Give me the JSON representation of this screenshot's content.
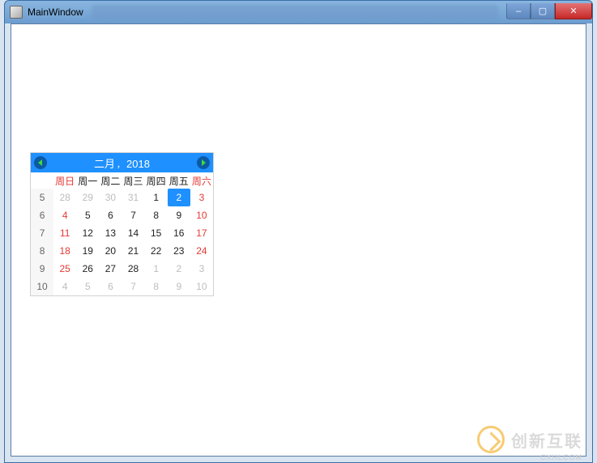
{
  "window": {
    "title": "MainWindow",
    "buttons": {
      "min": "–",
      "max": "▢",
      "close": "✕"
    }
  },
  "calendar": {
    "header": {
      "month": "二月",
      "sep": "，",
      "year": "2018"
    },
    "dow": [
      "周日",
      "周一",
      "周二",
      "周三",
      "周四",
      "周五",
      "周六"
    ],
    "rows": [
      {
        "week": "5",
        "days": [
          {
            "n": "28",
            "dim": true
          },
          {
            "n": "29",
            "dim": true
          },
          {
            "n": "30",
            "dim": true
          },
          {
            "n": "31",
            "dim": true
          },
          {
            "n": "1"
          },
          {
            "n": "2",
            "sel": true
          },
          {
            "n": "3",
            "red": true
          }
        ]
      },
      {
        "week": "6",
        "days": [
          {
            "n": "4",
            "red": true
          },
          {
            "n": "5"
          },
          {
            "n": "6"
          },
          {
            "n": "7"
          },
          {
            "n": "8"
          },
          {
            "n": "9"
          },
          {
            "n": "10",
            "red": true
          }
        ]
      },
      {
        "week": "7",
        "days": [
          {
            "n": "11",
            "red": true
          },
          {
            "n": "12"
          },
          {
            "n": "13"
          },
          {
            "n": "14"
          },
          {
            "n": "15"
          },
          {
            "n": "16"
          },
          {
            "n": "17",
            "red": true
          }
        ]
      },
      {
        "week": "8",
        "days": [
          {
            "n": "18",
            "red": true
          },
          {
            "n": "19"
          },
          {
            "n": "20"
          },
          {
            "n": "21"
          },
          {
            "n": "22"
          },
          {
            "n": "23"
          },
          {
            "n": "24",
            "red": true
          }
        ]
      },
      {
        "week": "9",
        "days": [
          {
            "n": "25",
            "red": true
          },
          {
            "n": "26"
          },
          {
            "n": "27"
          },
          {
            "n": "28"
          },
          {
            "n": "1",
            "dim": true
          },
          {
            "n": "2",
            "dim": true
          },
          {
            "n": "3",
            "dim": true
          }
        ]
      },
      {
        "week": "10",
        "days": [
          {
            "n": "4",
            "dim": true
          },
          {
            "n": "5",
            "dim": true
          },
          {
            "n": "6",
            "dim": true
          },
          {
            "n": "7",
            "dim": true
          },
          {
            "n": "8",
            "dim": true
          },
          {
            "n": "9",
            "dim": true
          },
          {
            "n": "10",
            "dim": true
          }
        ]
      }
    ]
  },
  "watermark": {
    "brand": "创新互联",
    "sub": "CXHLCOM"
  }
}
